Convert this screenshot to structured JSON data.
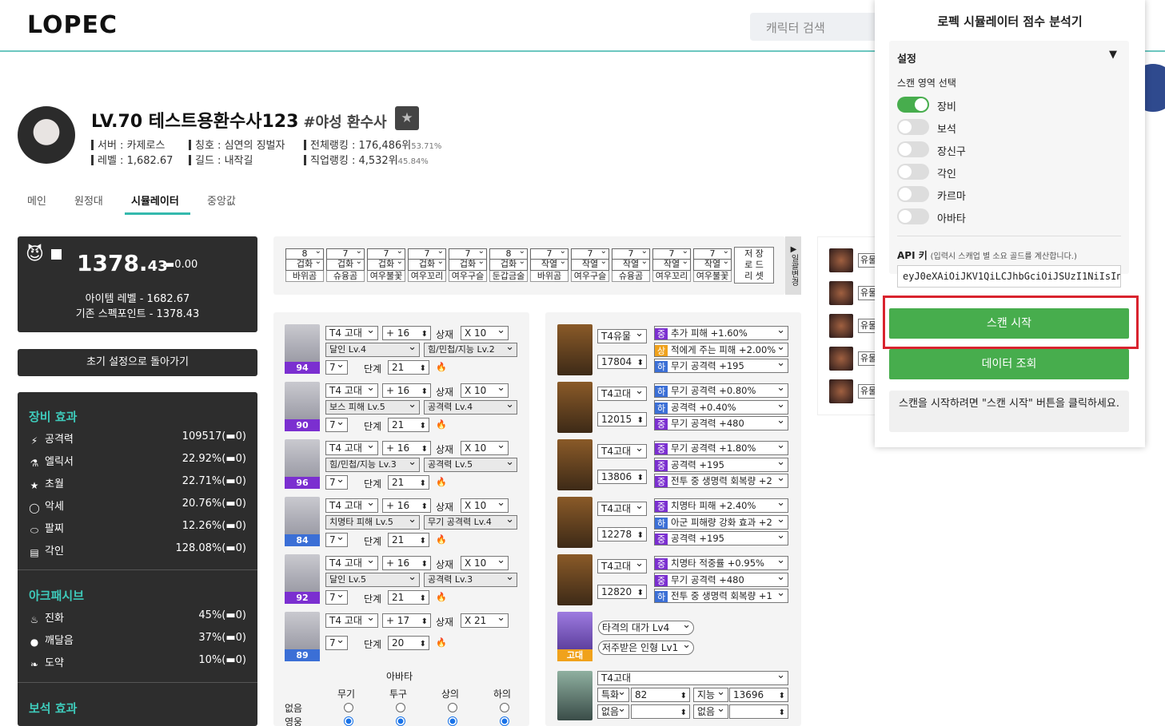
{
  "header": {
    "logo": "LOPEC",
    "search_placeholder": "캐릭터 검색"
  },
  "profile": {
    "name": "LV.70 테스트용환수사123",
    "class": "#야성 환수사",
    "server": "서버 : 카제로스",
    "level": "레벨 : 1,682.67",
    "title": "칭호 : 심연의 징벌자",
    "guild": "길드 : 내작길",
    "total_rank": "전체랭킹 : 176,486위",
    "total_pct": "53.71%",
    "class_rank": "직업랭킹 : 4,532위",
    "class_pct": "45.84%"
  },
  "tabs": [
    "메인",
    "원정대",
    "시뮬레이터",
    "중앙값"
  ],
  "score": {
    "main": "1378.",
    "decimal": "43",
    "delta": "0.00",
    "item_level": "아이템 레벨 - 1682.67",
    "base_spec": "기존 스펙포인트 - 1378.43"
  },
  "reset_label": "초기 설정으로 돌아가기",
  "equip_effects": {
    "title": "장비 효과",
    "rows": [
      {
        "icon": "sword-icon",
        "glyph": "⚡",
        "label": "공격력",
        "value": "109517(▬0)"
      },
      {
        "icon": "flask-icon",
        "glyph": "⚗",
        "label": "엘릭서",
        "value": "22.92%(▬0)"
      },
      {
        "icon": "star-icon",
        "glyph": "★",
        "label": "초월",
        "value": "22.71%(▬0)"
      },
      {
        "icon": "ring-icon",
        "glyph": "◯",
        "label": "악세",
        "value": "20.76%(▬0)"
      },
      {
        "icon": "bracelet-icon",
        "glyph": "⬭",
        "label": "팔찌",
        "value": "12.26%(▬0)"
      },
      {
        "icon": "book-icon",
        "glyph": "▤",
        "label": "각인",
        "value": "128.08%(▬0)"
      }
    ]
  },
  "ark_passive": {
    "title": "아크패시브",
    "rows": [
      {
        "icon": "flame-icon",
        "glyph": "♨",
        "label": "진화",
        "value": "45%(▬0)"
      },
      {
        "icon": "bulb-icon",
        "glyph": "●",
        "label": "깨달음",
        "value": "37%(▬0)"
      },
      {
        "icon": "leaf-icon",
        "glyph": "❧",
        "label": "도약",
        "value": "10%(▬0)"
      }
    ]
  },
  "gem_effects": {
    "title": "보석 효과"
  },
  "engrave_bar": {
    "columns": [
      {
        "lv": "8",
        "grade": "겁화",
        "name": "바위곰"
      },
      {
        "lv": "7",
        "grade": "겁화",
        "name": "슈융곰"
      },
      {
        "lv": "7",
        "grade": "겁화",
        "name": "여우불꽃"
      },
      {
        "lv": "7",
        "grade": "겁화",
        "name": "여우꼬리"
      },
      {
        "lv": "7",
        "grade": "겁화",
        "name": "여우구슬"
      },
      {
        "lv": "8",
        "grade": "겁화",
        "name": "둔갑금술"
      },
      {
        "lv": "7",
        "grade": "작열",
        "name": "바위곰"
      },
      {
        "lv": "7",
        "grade": "작열",
        "name": "여우구슬"
      },
      {
        "lv": "7",
        "grade": "작열",
        "name": "슈융곰"
      },
      {
        "lv": "7",
        "grade": "작열",
        "name": "여우꼬리"
      },
      {
        "lv": "7",
        "grade": "작열",
        "name": "여우불꽃"
      }
    ],
    "save_load_reset": [
      "저 장",
      "로 드",
      "리 셋"
    ],
    "bulk_change": "일괄변경"
  },
  "gear": [
    {
      "level": "94",
      "tier": "T4 고대",
      "plus": "+ 16",
      "sangjae": "상재",
      "mult": "X 10",
      "eff1": "달인 Lv.4",
      "eff2": "힘/민첩/지능 Lv.2",
      "stage": "7",
      "stage_label": "단계",
      "step": "21"
    },
    {
      "level": "90",
      "tier": "T4 고대",
      "plus": "+ 16",
      "sangjae": "상재",
      "mult": "X 10",
      "eff1": "보스 피해 Lv.5",
      "eff2": "공격력 Lv.4",
      "stage": "7",
      "stage_label": "단계",
      "step": "21"
    },
    {
      "level": "96",
      "tier": "T4 고대",
      "plus": "+ 16",
      "sangjae": "상재",
      "mult": "X 10",
      "eff1": "힘/민첩/지능 Lv.3",
      "eff2": "공격력 Lv.5",
      "stage": "7",
      "stage_label": "단계",
      "step": "21"
    },
    {
      "level": "84",
      "tier": "T4 고대",
      "plus": "+ 16",
      "sangjae": "상재",
      "mult": "X 10",
      "eff1": "치명타 피해 Lv.5",
      "eff2": "무기 공격력 Lv.4",
      "stage": "7",
      "stage_label": "단계",
      "step": "21"
    },
    {
      "level": "92",
      "tier": "T4 고대",
      "plus": "+ 16",
      "sangjae": "상재",
      "mult": "X 10",
      "eff1": "달인 Lv.5",
      "eff2": "공격력 Lv.3",
      "stage": "7",
      "stage_label": "단계",
      "step": "21"
    },
    {
      "level": "89",
      "tier": "T4 고대",
      "plus": "+ 17",
      "sangjae": "상재",
      "mult": "X 21",
      "stage": "7",
      "stage_label": "단계",
      "step": "20"
    }
  ],
  "avatar": {
    "title": "아바타",
    "cols": [
      "무기",
      "투구",
      "상의",
      "하의"
    ],
    "rows": [
      "없음",
      "영웅"
    ]
  },
  "accessories": [
    {
      "tier": "T4유물",
      "value": "17804",
      "opts": [
        {
          "g": "중",
          "t": "추가 피해 +1.60%"
        },
        {
          "g": "상",
          "t": "적에게 주는 피해 +2.00%"
        },
        {
          "g": "하",
          "t": "무기 공격력 +195"
        }
      ]
    },
    {
      "tier": "T4고대",
      "value": "12015",
      "opts": [
        {
          "g": "하",
          "t": "무기 공격력 +0.80%"
        },
        {
          "g": "하",
          "t": "공격력 +0.40%"
        },
        {
          "g": "중",
          "t": "무기 공격력 +480"
        }
      ]
    },
    {
      "tier": "T4고대",
      "value": "13806",
      "opts": [
        {
          "g": "중",
          "t": "무기 공격력 +1.80%"
        },
        {
          "g": "중",
          "t": "공격력 +195"
        },
        {
          "g": "중",
          "t": "전투 중 생명력 회복량 +2"
        }
      ]
    },
    {
      "tier": "T4고대",
      "value": "12278",
      "opts": [
        {
          "g": "중",
          "t": "치명타 피해 +2.40%"
        },
        {
          "g": "하",
          "t": "아군 피해량 강화 효과 +2"
        },
        {
          "g": "중",
          "t": "공격력 +195"
        }
      ]
    },
    {
      "tier": "T4고대",
      "value": "12820",
      "opts": [
        {
          "g": "중",
          "t": "치명타 적중률 +0.95%"
        },
        {
          "g": "중",
          "t": "무기 공격력 +480"
        },
        {
          "g": "하",
          "t": "전투 중 생명력 회복량 +1"
        }
      ]
    }
  ],
  "stone": {
    "grade": "고대",
    "opt1": "타격의 대가 Lv4",
    "opt2": "저주받은 인형 Lv1"
  },
  "bracelet": {
    "tier": "T4고대",
    "s1": "특화",
    "v1": "82",
    "s2": "지능",
    "v2": "13696",
    "n1": "없음",
    "n2": "없음"
  },
  "side": {
    "label": "유물"
  },
  "popup": {
    "title": "로펙 시뮬레이터 점수 분석기",
    "settings": "설정",
    "scan_area": "스캔 영역 선택",
    "toggles": [
      {
        "label": "장비",
        "on": true
      },
      {
        "label": "보석",
        "on": false
      },
      {
        "label": "장신구",
        "on": false
      },
      {
        "label": "각인",
        "on": false
      },
      {
        "label": "카르마",
        "on": false
      },
      {
        "label": "아바타",
        "on": false
      }
    ],
    "api_label": "API 키",
    "api_hint": "(입력시 스캐업 별 소요 골드를 계산합니다.)",
    "api_value": "eyJ0eXAiOiJKV1QiLCJhbGciOiJSUzI1NiIsIn",
    "scan_button": "스캔 시작",
    "data_button": "데이터 조회",
    "info": "스캔을 시작하려면 \"스캔 시작\" 버튼을 클릭하세요."
  },
  "colors": {
    "accent": "#34b9ad",
    "green": "#47ad4d",
    "purple": "#7b2fd0",
    "blue": "#3b6fd6",
    "orange": "#f0a21c",
    "red_highlight": "#d9232e"
  }
}
